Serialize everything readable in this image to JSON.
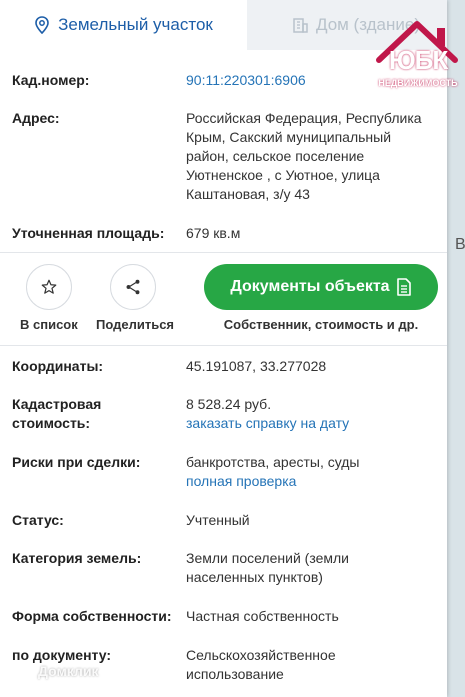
{
  "tabs": [
    {
      "label": "Земельный участок"
    },
    {
      "label": "Дом (здание)"
    }
  ],
  "fields": {
    "cadastral_label": "Кад.номер:",
    "cadastral_value": "90:11:220301:6906",
    "address_label": "Адрес:",
    "address_value": "Российская Федерация, Республика Крым, Сакский муниципальный район, сельское поселение Уютненское , с Уютное, улица Каштановая, з/у 43",
    "area_label": "Уточненная площадь:",
    "area_value": "679 кв.м",
    "coords_label": "Координаты:",
    "coords_value": "45.191087, 33.277028",
    "cost_label": "Кадастровая стоимость:",
    "cost_value": "8 528.24 руб.",
    "cost_link": "заказать справку на дату",
    "risks_label": "Риски при сделки:",
    "risks_value": "банкротства, аресты, суды",
    "risks_link": "полная проверка",
    "status_label": "Статус:",
    "status_value": "Учтенный",
    "category_label": "Категория земель:",
    "category_value": "Земли поселений (земли населенных пунктов)",
    "ownership_label": "Форма собственности:",
    "ownership_value": "Частная собственность",
    "usage_label": "по документу:",
    "usage_value": "Сельскохозяйственное использование"
  },
  "actions": {
    "favorite_label": "В список",
    "share_label": "Поделиться",
    "documents_label": "Документы объекта",
    "documents_sub": "Собственник, стоимость и др."
  },
  "overlay": {
    "logo_main": "ЮБК",
    "logo_sub": "НЕДВИЖИМОСТЬ",
    "watermark": "Домклик",
    "map_char": "Вс"
  },
  "colors": {
    "accent_blue": "#1d5ea8",
    "link_blue": "#2574b7",
    "green_button": "#27a745",
    "logo_red": "#c0174a"
  },
  "icons": {
    "tab_land": "location-pin-icon",
    "tab_house": "building-icon",
    "favorite": "star-icon",
    "share": "share-icon",
    "documents": "document-icon"
  }
}
